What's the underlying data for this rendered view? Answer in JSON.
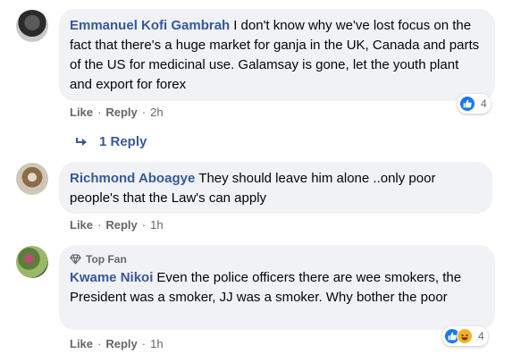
{
  "comments": [
    {
      "author": "Emmanuel Kofi Gambrah",
      "text": "I don't know why we've lost focus on the fact that there's a huge market for ganja in the UK, Canada and parts of the US for medicinal use. Galamsay is gone, let the youth plant and export for forex",
      "like_label": "Like",
      "reply_label": "Reply",
      "time": "2h",
      "reaction_count": "4",
      "reactions": [
        "like-icon"
      ],
      "replies_label": "1 Reply"
    },
    {
      "author": "Richmond Aboagye",
      "text": "They should leave him alone ..only poor people's that the Law's can apply",
      "like_label": "Like",
      "reply_label": "Reply",
      "time": "1h"
    },
    {
      "badge": "Top Fan",
      "author": "Kwame Nikoi",
      "text": "Even the police officers there are wee smokers, the President was a smoker, JJ was a smoker. Why bother the poor",
      "like_label": "Like",
      "reply_label": "Reply",
      "time": "1h",
      "reaction_count": "4",
      "reactions": [
        "like-icon",
        "haha-icon"
      ]
    }
  ],
  "separator": "·",
  "colors": {
    "author": "#385898",
    "bubble": "#f0f2f5",
    "meta": "#65676b",
    "like_blue": "#1877f2",
    "haha_yellow": "#f7b125"
  }
}
